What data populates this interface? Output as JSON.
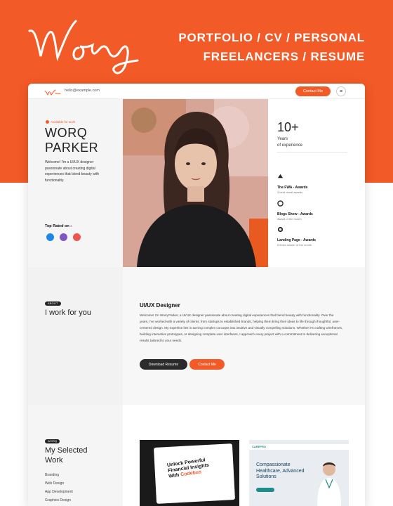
{
  "brand": {
    "logo_text": "Worq",
    "accent_color": "#f25a27",
    "dark_color": "#2b2b2b"
  },
  "taglines": [
    "PORTFOLIO  /  CV  /  PERSONAL",
    "FREELANCERS  /  RESUME"
  ],
  "nav": {
    "logo_text": "Worq",
    "email": "hello@example.com",
    "contact_label": "Contact Me",
    "menu_icon": "hamburger-icon"
  },
  "hero": {
    "availability": "Available for work",
    "name_line1": "WORQ",
    "name_line2": "PARKER",
    "intro": "Welcome! I'm a UI/UX designer passionate about creating digital experiences that blend beauty with functionality.",
    "top_rated_label": "Top Rated on :",
    "top_rated_icons": [
      "upwork-icon",
      "fiverr-icon",
      "dribbble-icon"
    ]
  },
  "experience": {
    "number": "10+",
    "label_line1": "Years",
    "label_line2": "of experience"
  },
  "awards": [
    {
      "icon": "fwa-icon",
      "title": "The FWA - Awards",
      "subtitle": "3 best visual awards"
    },
    {
      "icon": "blogs-icon",
      "title": "Blogs Show - Awards",
      "subtitle": "Award of the month"
    },
    {
      "icon": "landing-icon",
      "title": "Landing Page - Awards",
      "subtitle": "5 times winner of the month"
    }
  ],
  "about": {
    "badge": "ABOUT",
    "heading": "I work for you",
    "title": "UI/UX Designer",
    "body": "Welcome! I'm Worq Parker, a UI/UX designer passionate about creating digital experiences that blend beauty with functionality. Over the years, I've worked with a variety of clients, from startups to established brands, helping them bring their ideas to life through thoughtful, user-centered design. My expertise lies in turning complex concepts into intuitive and visually compelling solutions. Whether it's crafting wireframes, building interactive prototypes, or designing complete user interfaces, I approach every project with a commitment to delivering exceptional results tailored to your needs.",
    "download_label": "Download Resume",
    "contact_label": "Contact Me"
  },
  "works": {
    "badge": "WORQ",
    "heading_line1": "My Selected",
    "heading_line2": "Work",
    "categories": [
      "Branding",
      "Web Design",
      "App Development",
      "Graphics Design"
    ],
    "card1": {
      "title_a": "Unlock Powerful Financial",
      "title_b": "Insights With",
      "title_accent": "Codebus"
    },
    "card2": {
      "logo": "CAREPRO",
      "title": "Compassionate Healthcare, Advanced Solutions"
    }
  }
}
